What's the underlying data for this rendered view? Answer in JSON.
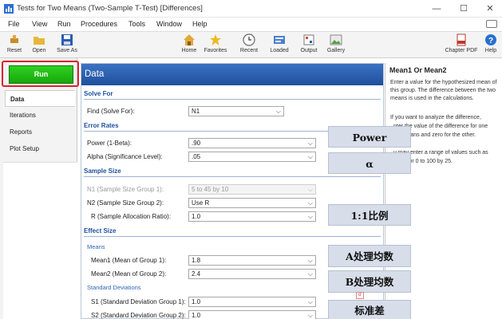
{
  "window": {
    "title": "Tests for Two Means (Two-Sample T-Test) [Differences]",
    "controls": [
      "—",
      "☐",
      "✕"
    ]
  },
  "menu": [
    "File",
    "View",
    "Run",
    "Procedures",
    "Tools",
    "Window",
    "Help"
  ],
  "toolbar": {
    "reset": "Reset",
    "open": "Open",
    "save_as": "Save As",
    "home": "Home",
    "favorites": "Favorites",
    "recent": "Recent",
    "loaded": "Loaded",
    "output": "Output",
    "gallery": "Gallery",
    "chapter_pdf": "Chapter PDF",
    "help": "Help"
  },
  "left": {
    "run": "Run",
    "tabs": [
      "Data",
      "Iterations",
      "Reports",
      "Plot Setup"
    ],
    "active_tab": "Data"
  },
  "panel": {
    "header": "Data",
    "sections": {
      "solve_for": "Solve For",
      "error_rates": "Error Rates",
      "sample_size": "Sample Size",
      "effect_size": "Effect Size",
      "means": "Means",
      "std_devs": "Standard Deviations"
    },
    "fields": {
      "find": {
        "label": "Find (Solve For):",
        "value": "N1"
      },
      "power": {
        "label": "Power (1-Beta):",
        "value": ".90"
      },
      "alpha": {
        "label": "Alpha (Significance Level):",
        "value": ".05"
      },
      "n1": {
        "label": "N1 (Sample Size Group 1):",
        "value": "5 to 45 by 10"
      },
      "n2": {
        "label": "N2 (Sample Size Group 2):",
        "value": "Use R"
      },
      "r": {
        "label": "R (Sample Allocation Ratio):",
        "value": "1.0"
      },
      "mean1": {
        "label": "Mean1 (Mean of Group 1):",
        "value": "1.8"
      },
      "mean2": {
        "label": "Mean2 (Mean of Group 2):",
        "value": "2.4"
      },
      "s1": {
        "label": "S1 (Standard Deviation Group 1):",
        "value": "1.0"
      },
      "s2": {
        "label": "S2 (Standard Deviation Group 2):",
        "value": "1.0"
      }
    }
  },
  "help": {
    "title": "Mean1 Or Mean2",
    "p1": "Enter a value for the hypothesized mean of this group. The difference between the two means is used in the calculations.",
    "p2a": "If you want to analyze the difference,",
    "p2b": "nter the value of the difference for one",
    "p2c": "the means and zero for the other.",
    "p3a": "u may enter a range of values such as",
    "p3b": "20,30 or 0 to 100 by 25."
  },
  "overlays": {
    "power": "Power",
    "alpha": "α",
    "ratio": "1:1比例",
    "mean_a": "A处理均数",
    "mean_b": "B处理均数",
    "std": "标准差",
    "small": "σ"
  },
  "colors": {
    "run_green": "#17a80d",
    "header_blue": "#1f4f9c",
    "highlight_red": "#d9232e",
    "overlay_bg": "#d7dde9"
  }
}
